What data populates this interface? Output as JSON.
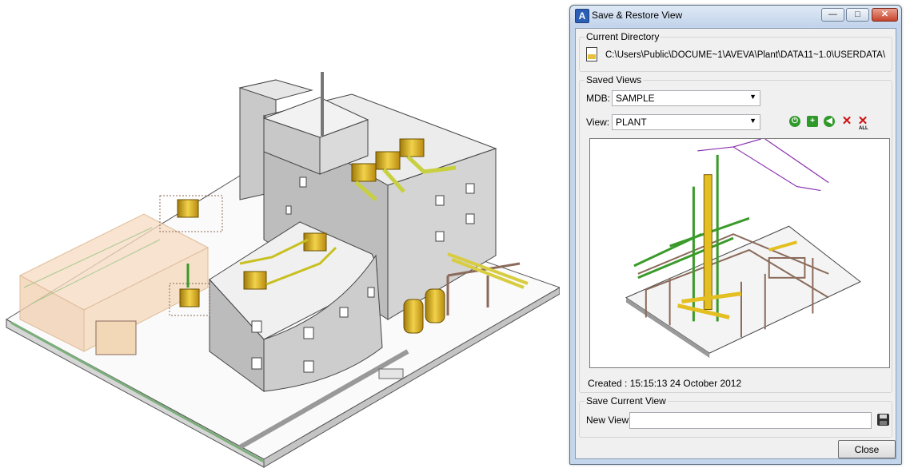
{
  "window": {
    "title": "Save & Restore View",
    "app_icon": "aveva-app-icon",
    "caption_buttons": {
      "minimize": "—",
      "maximize": "□",
      "close": "✕"
    }
  },
  "current_directory": {
    "group_label": "Current Directory",
    "path": "C:\\Users\\Public\\DOCUME~1\\AVEVA\\Plant\\DATA11~1.0\\USERDATA\\"
  },
  "saved_views": {
    "group_label": "Saved Views",
    "mdb_label": "MDB:",
    "mdb_value": "SAMPLE",
    "view_label": "View:",
    "view_value": "PLANT",
    "toolbar_icons": [
      "restore-view-icon",
      "add-view-icon",
      "overwrite-view-icon",
      "delete-view-icon",
      "delete-all-views-icon"
    ],
    "delete_all_caption": "ALL",
    "created_text": "Created : 15:15:13 24 October 2012"
  },
  "save_current_view": {
    "group_label": "Save Current View",
    "new_view_label": "New View:",
    "new_view_value": ""
  },
  "close_label": "Close",
  "colors": {
    "titlebar": "#c4d6ec",
    "client": "#f0f0f0",
    "steel": "#8a6a5a",
    "pipe_yellow": "#e6c31a",
    "pipe_green": "#3a9a2a",
    "pipe_purple": "#7a2fa8"
  }
}
